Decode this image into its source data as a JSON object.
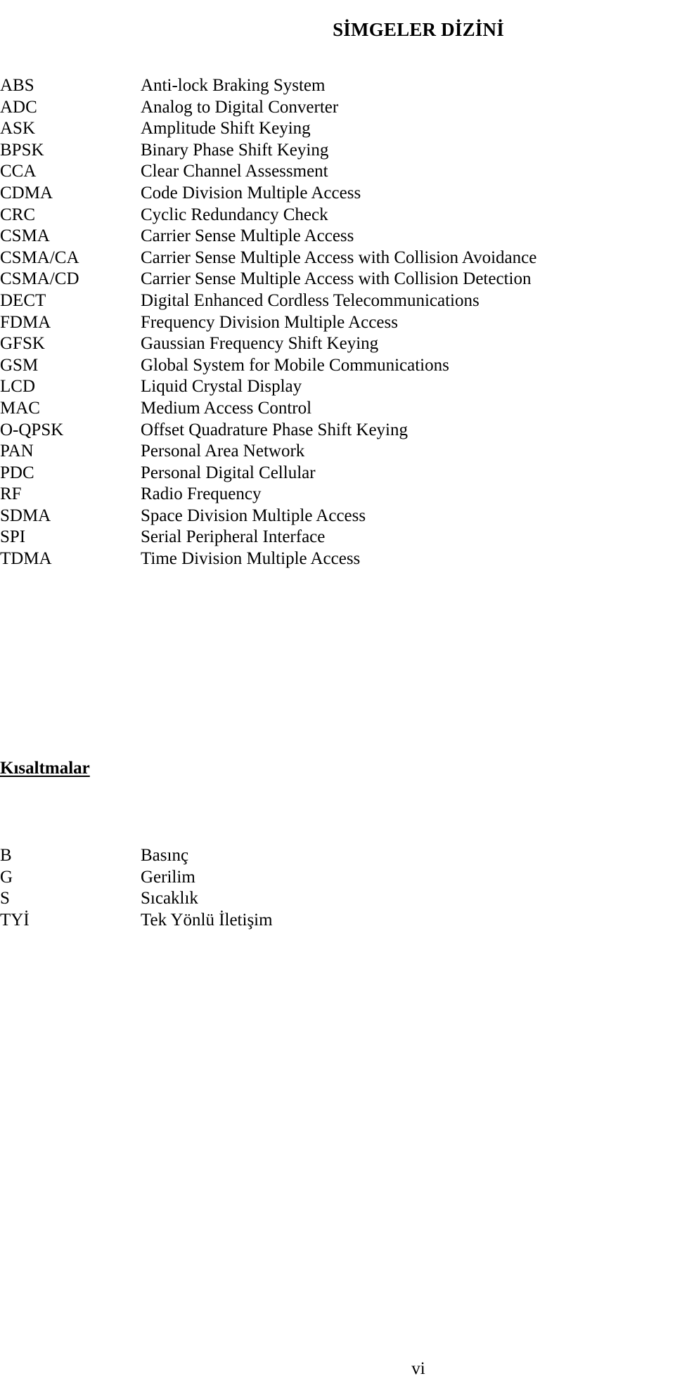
{
  "document": {
    "title": "SİMGELER DİZİNİ",
    "page_number": "vi"
  },
  "acronyms": {
    "rows": [
      {
        "term": "ABS",
        "definition": "Anti-lock Braking System"
      },
      {
        "term": "ADC",
        "definition": "Analog to Digital Converter"
      },
      {
        "term": "ASK",
        "definition": "Amplitude Shift Keying"
      },
      {
        "term": "BPSK",
        "definition": "Binary Phase Shift Keying"
      },
      {
        "term": "CCA",
        "definition": "Clear Channel Assessment"
      },
      {
        "term": "CDMA",
        "definition": "Code Division Multiple Access"
      },
      {
        "term": "CRC",
        "definition": "Cyclic Redundancy Check"
      },
      {
        "term": "CSMA",
        "definition": "Carrier Sense Multiple Access"
      },
      {
        "term": "CSMA/CA",
        "definition": "Carrier Sense Multiple Access with Collision Avoidance"
      },
      {
        "term": "CSMA/CD",
        "definition": "Carrier Sense Multiple Access with Collision Detection"
      },
      {
        "term": "DECT",
        "definition": "Digital Enhanced Cordless Telecommunications"
      },
      {
        "term": "FDMA",
        "definition": "Frequency Division Multiple Access"
      },
      {
        "term": "GFSK",
        "definition": "Gaussian Frequency Shift Keying"
      },
      {
        "term": "GSM",
        "definition": "Global System for Mobile Communications"
      },
      {
        "term": "LCD",
        "definition": "Liquid Crystal Display"
      },
      {
        "term": "MAC",
        "definition": "Medium Access Control"
      },
      {
        "term": "O-QPSK",
        "definition": "Offset Quadrature Phase Shift Keying"
      },
      {
        "term": "PAN",
        "definition": "Personal Area Network"
      },
      {
        "term": "PDC",
        "definition": "Personal Digital Cellular"
      },
      {
        "term": "RF",
        "definition": "Radio Frequency"
      },
      {
        "term": "SDMA",
        "definition": "Space Division Multiple Access"
      },
      {
        "term": "SPI",
        "definition": "Serial Peripheral Interface"
      },
      {
        "term": "TDMA",
        "definition": "Time Division Multiple Access"
      }
    ]
  },
  "abbreviations_section": {
    "heading": "Kısaltmalar",
    "rows": [
      {
        "term": "B",
        "definition": "Basınç"
      },
      {
        "term": "G",
        "definition": "Gerilim"
      },
      {
        "term": "S",
        "definition": "Sıcaklık"
      },
      {
        "term": "TYİ",
        "definition": "Tek Yönlü İletişim"
      }
    ]
  }
}
